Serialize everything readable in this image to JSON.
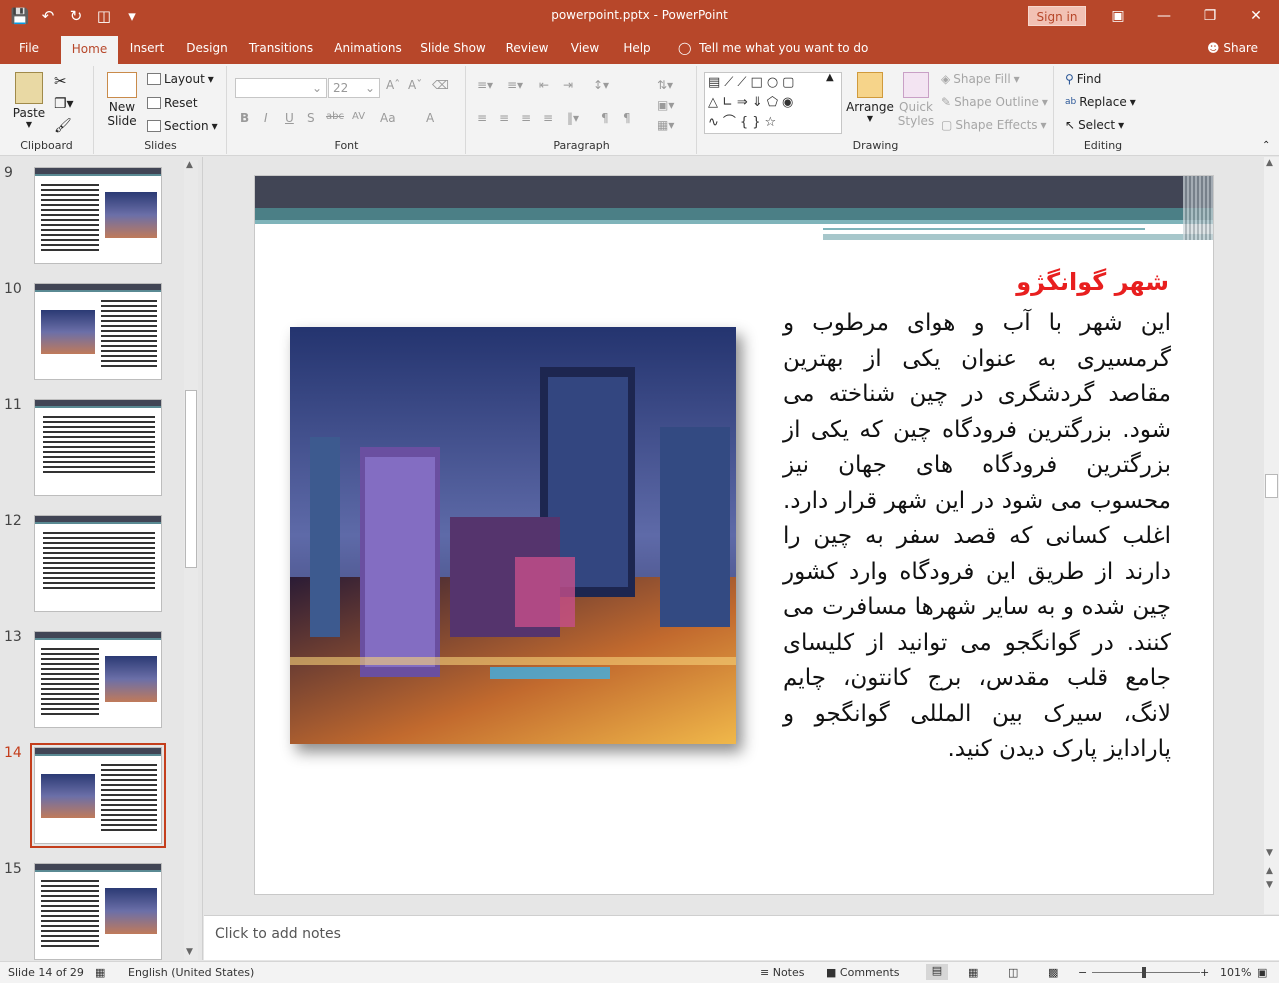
{
  "window": {
    "title": "powerpoint.pptx  -  PowerPoint",
    "signin": "Sign in"
  },
  "tabs": [
    "File",
    "Home",
    "Insert",
    "Design",
    "Transitions",
    "Animations",
    "Slide Show",
    "Review",
    "View",
    "Help"
  ],
  "active_tab": "Home",
  "tellme": "Tell me what you want to do",
  "share": "Share",
  "ribbon": {
    "clipboard": {
      "label": "Clipboard",
      "paste": "Paste"
    },
    "slides": {
      "label": "Slides",
      "new_slide": "New",
      "new_slide2": "Slide",
      "layout": "Layout",
      "reset": "Reset",
      "section": "Section"
    },
    "font": {
      "label": "Font",
      "size": "22",
      "bold": "B",
      "italic": "I",
      "underline": "U",
      "shadow": "S",
      "strike": "abc",
      "spacing": "AV",
      "case": "Aa",
      "color": "A"
    },
    "paragraph": {
      "label": "Paragraph"
    },
    "drawing": {
      "label": "Drawing",
      "arrange": "Arrange",
      "quick_styles": "Quick",
      "quick_styles2": "Styles",
      "shape_fill": "Shape Fill",
      "shape_outline": "Shape Outline",
      "shape_effects": "Shape Effects"
    },
    "editing": {
      "label": "Editing",
      "find": "Find",
      "replace": "Replace",
      "select": "Select"
    }
  },
  "thumbnails": [
    {
      "num": "9",
      "active": false,
      "layout": "right-img"
    },
    {
      "num": "10",
      "active": false,
      "layout": "left-img"
    },
    {
      "num": "11",
      "active": false,
      "layout": "text"
    },
    {
      "num": "12",
      "active": false,
      "layout": "text"
    },
    {
      "num": "13",
      "active": false,
      "layout": "right-img"
    },
    {
      "num": "14",
      "active": true,
      "layout": "left-img"
    },
    {
      "num": "15",
      "active": false,
      "layout": "right-img"
    }
  ],
  "slide": {
    "title": "شهر گوانگژو",
    "body": "این شهر با آب و هوای مرطوب و گرمسیری به عنوان یکی از بهترین مقاصد گردشگری در چین شناخته می شود. بزرگترین فرودگاه چین که یکی از بزرگترین فرودگاه های جهان نیز محسوب می شود در این شهر قرار دارد. اغلب کسانی که قصد سفر به چین را دارند از طریق این فرودگاه وارد کشور چین شده و به سایر شهرها مسافرت می کنند. در گوانگجو می توانید از کلیسای جامع قلب مقدس، برج کانتون، چایم لانگ، سیرک بین المللی گوانگجو و پارادایز پارک دیدن کنید."
  },
  "notes_placeholder": "Click to add notes",
  "status": {
    "slide_info": "Slide 14 of 29",
    "language": "English (United States)",
    "notes": "Notes",
    "comments": "Comments",
    "zoom": "101%"
  },
  "colors": {
    "accent": "#b7472a",
    "title_red": "#e81f1f",
    "header_dark": "#414555",
    "header_teal": "#4b7f86"
  }
}
